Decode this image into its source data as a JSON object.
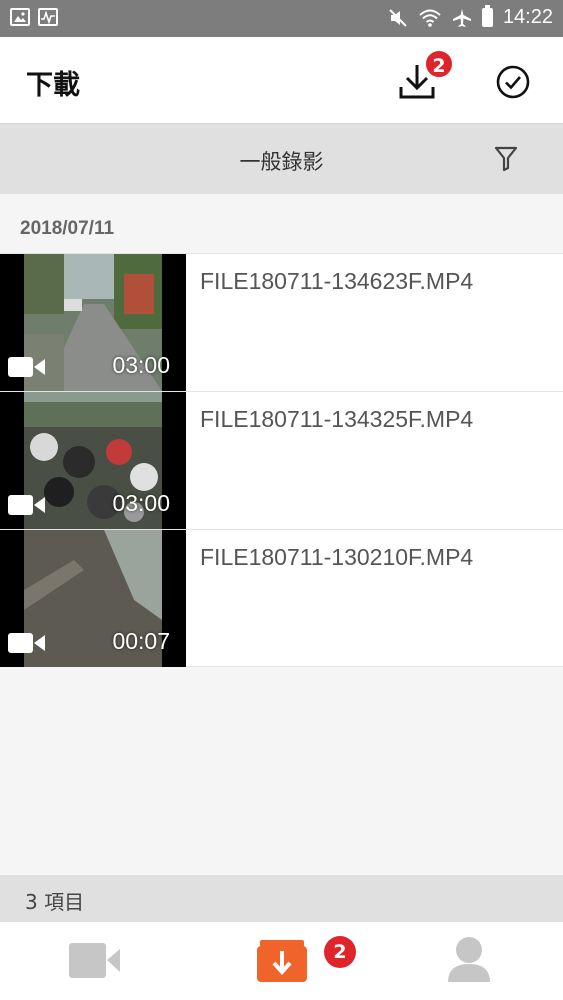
{
  "status_bar": {
    "time": "14:22",
    "icons": [
      "gallery-icon",
      "activity-icon",
      "mute-icon",
      "wifi-icon",
      "airplane-icon",
      "battery-icon"
    ]
  },
  "app_bar": {
    "title": "下載",
    "download_badge": "2",
    "icons": [
      "download-icon",
      "check-circle-icon"
    ]
  },
  "filter_bar": {
    "label": "一般錄影",
    "icon": "filter-icon"
  },
  "section": {
    "date": "2018/07/11",
    "files": [
      {
        "name": "FILE180711-134623F.MP4",
        "duration": "03:00",
        "thumb": "street-scene"
      },
      {
        "name": "FILE180711-134325F.MP4",
        "duration": "03:00",
        "thumb": "scooters"
      },
      {
        "name": "FILE180711-130210F.MP4",
        "duration": "00:07",
        "thumb": "tilted-road"
      }
    ]
  },
  "footer": {
    "count": "3 項目"
  },
  "bottom_nav": {
    "items": [
      {
        "icon": "video-camera-icon",
        "active": false
      },
      {
        "icon": "download-box-icon",
        "active": true
      },
      {
        "icon": "person-icon",
        "active": false
      }
    ],
    "badge": "2",
    "colors": {
      "active": "#f0642c",
      "inactive": "#c6c6c6",
      "badge": "#e0242c"
    }
  }
}
